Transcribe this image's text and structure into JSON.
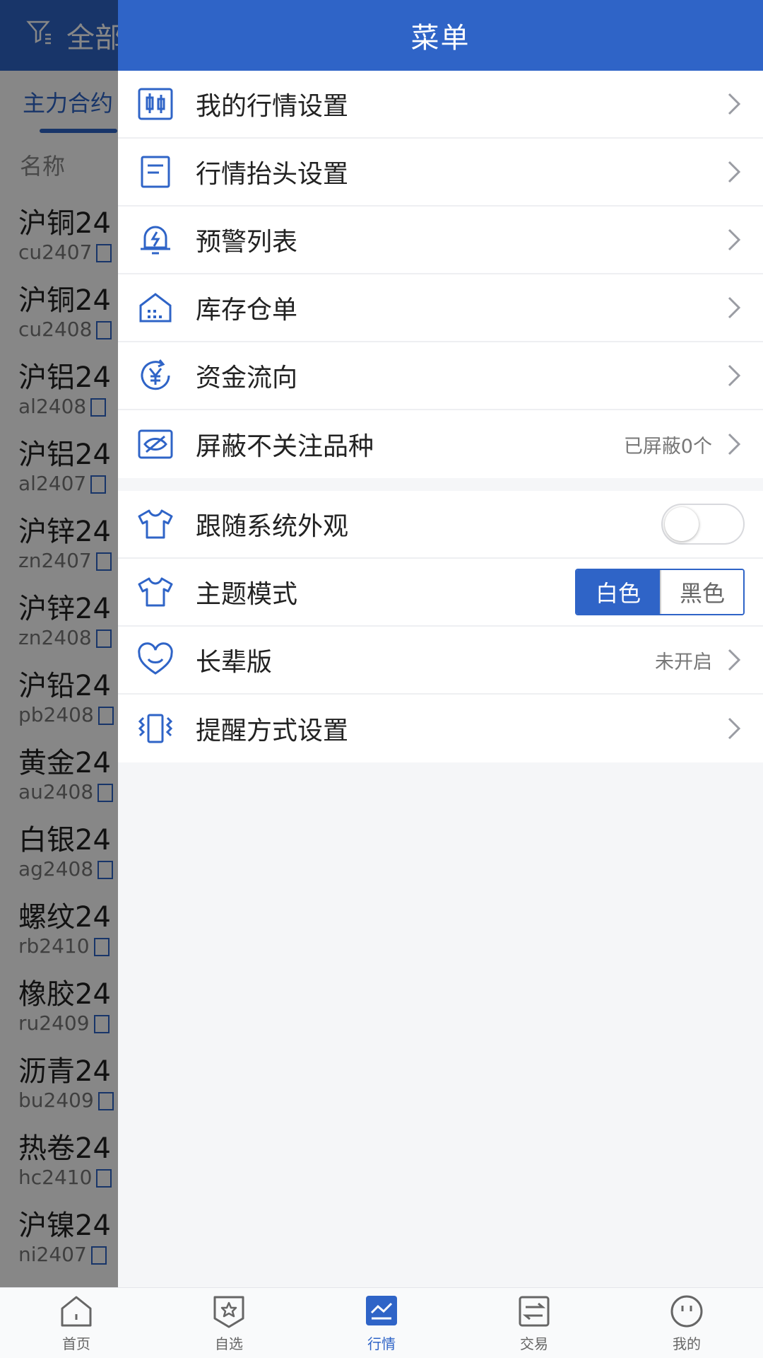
{
  "background": {
    "header_title": "全部",
    "tab": "主力合约",
    "column_header": "名称",
    "rows": [
      {
        "name": "沪铜24",
        "code": "cu2407"
      },
      {
        "name": "沪铜24",
        "code": "cu2408"
      },
      {
        "name": "沪铝24",
        "code": "al2408"
      },
      {
        "name": "沪铝24",
        "code": "al2407"
      },
      {
        "name": "沪锌24",
        "code": "zn2407"
      },
      {
        "name": "沪锌24",
        "code": "zn2408"
      },
      {
        "name": "沪铅24",
        "code": "pb2408"
      },
      {
        "name": "黄金24",
        "code": "au2408"
      },
      {
        "name": "白银24",
        "code": "ag2408"
      },
      {
        "name": "螺纹24",
        "code": "rb2410"
      },
      {
        "name": "橡胶24",
        "code": "ru2409"
      },
      {
        "name": "沥青24",
        "code": "bu2409"
      },
      {
        "name": "热卷24",
        "code": "hc2410"
      },
      {
        "name": "沪镍24",
        "code": "ni2407"
      }
    ]
  },
  "menu": {
    "title": "菜单",
    "group1": [
      {
        "label": "我的行情设置",
        "icon": "candlestick-icon"
      },
      {
        "label": "行情抬头设置",
        "icon": "document-icon"
      },
      {
        "label": "预警列表",
        "icon": "alert-bell-icon"
      },
      {
        "label": "库存仓单",
        "icon": "warehouse-icon"
      },
      {
        "label": "资金流向",
        "icon": "yuan-flow-icon"
      },
      {
        "label": "屏蔽不关注品种",
        "icon": "eye-hidden-icon",
        "right_text": "已屏蔽0个"
      }
    ],
    "group2": {
      "follow_system": {
        "label": "跟随系统外观",
        "icon": "shirt-icon",
        "enabled": false
      },
      "theme": {
        "label": "主题模式",
        "icon": "shirt-icon",
        "options": [
          "白色",
          "黑色"
        ],
        "selected": "白色"
      },
      "elder": {
        "label": "长辈版",
        "icon": "heart-smile-icon",
        "right_text": "未开启"
      },
      "reminder": {
        "label": "提醒方式设置",
        "icon": "vibrate-icon"
      }
    }
  },
  "bottom_nav": {
    "items": [
      {
        "label": "首页",
        "icon": "home-icon"
      },
      {
        "label": "自选",
        "icon": "star-badge-icon"
      },
      {
        "label": "行情",
        "icon": "market-chart-icon",
        "active": true
      },
      {
        "label": "交易",
        "icon": "exchange-icon"
      },
      {
        "label": "我的",
        "icon": "profile-face-icon"
      }
    ]
  },
  "colors": {
    "primary": "#2f64c7",
    "overlay": "rgba(0,0,0,0.47)"
  }
}
